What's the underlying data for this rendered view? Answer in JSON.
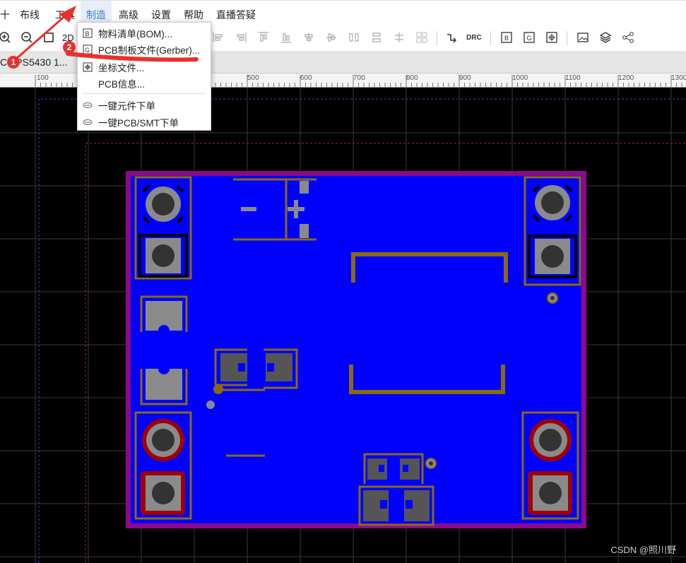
{
  "menubar": {
    "items": [
      "十",
      "布线",
      "工具",
      "制造",
      "高级",
      "设置",
      "帮助",
      "直播答疑"
    ]
  },
  "toolbar": {
    "view_2d_label": "2D",
    "drc_label": "DRC"
  },
  "tab": {
    "title": "C TPS5430 1..."
  },
  "ruler": {
    "ticks": [
      "100",
      "500",
      "600",
      "700",
      "800",
      "900",
      "1000",
      "1100",
      "1200",
      "1300"
    ]
  },
  "dropdown": {
    "items": [
      {
        "label": "物料清单(BOM)...",
        "icon": "b-doc-icon"
      },
      {
        "label": "PCB制板文件(Gerber)...",
        "icon": "g-doc-icon"
      },
      {
        "label": "坐标文件...",
        "icon": "coordinate-icon"
      },
      {
        "label": "PCB信息...",
        "icon": ""
      },
      {
        "label": "一键元件下单",
        "icon": "order-icon"
      },
      {
        "label": "一键PCB/SMT下单",
        "icon": "order-icon"
      }
    ]
  },
  "annotations": {
    "step1": "1",
    "step2": "2"
  },
  "colors": {
    "board_fill": "#0000ff",
    "board_outline": "#8b0a8b",
    "silkscreen": "#8a6a10",
    "pad": "#8a8a8a",
    "annotation": "#e8312f",
    "menu_active": "#3a7bd5"
  },
  "watermark": "CSDN @照川野"
}
